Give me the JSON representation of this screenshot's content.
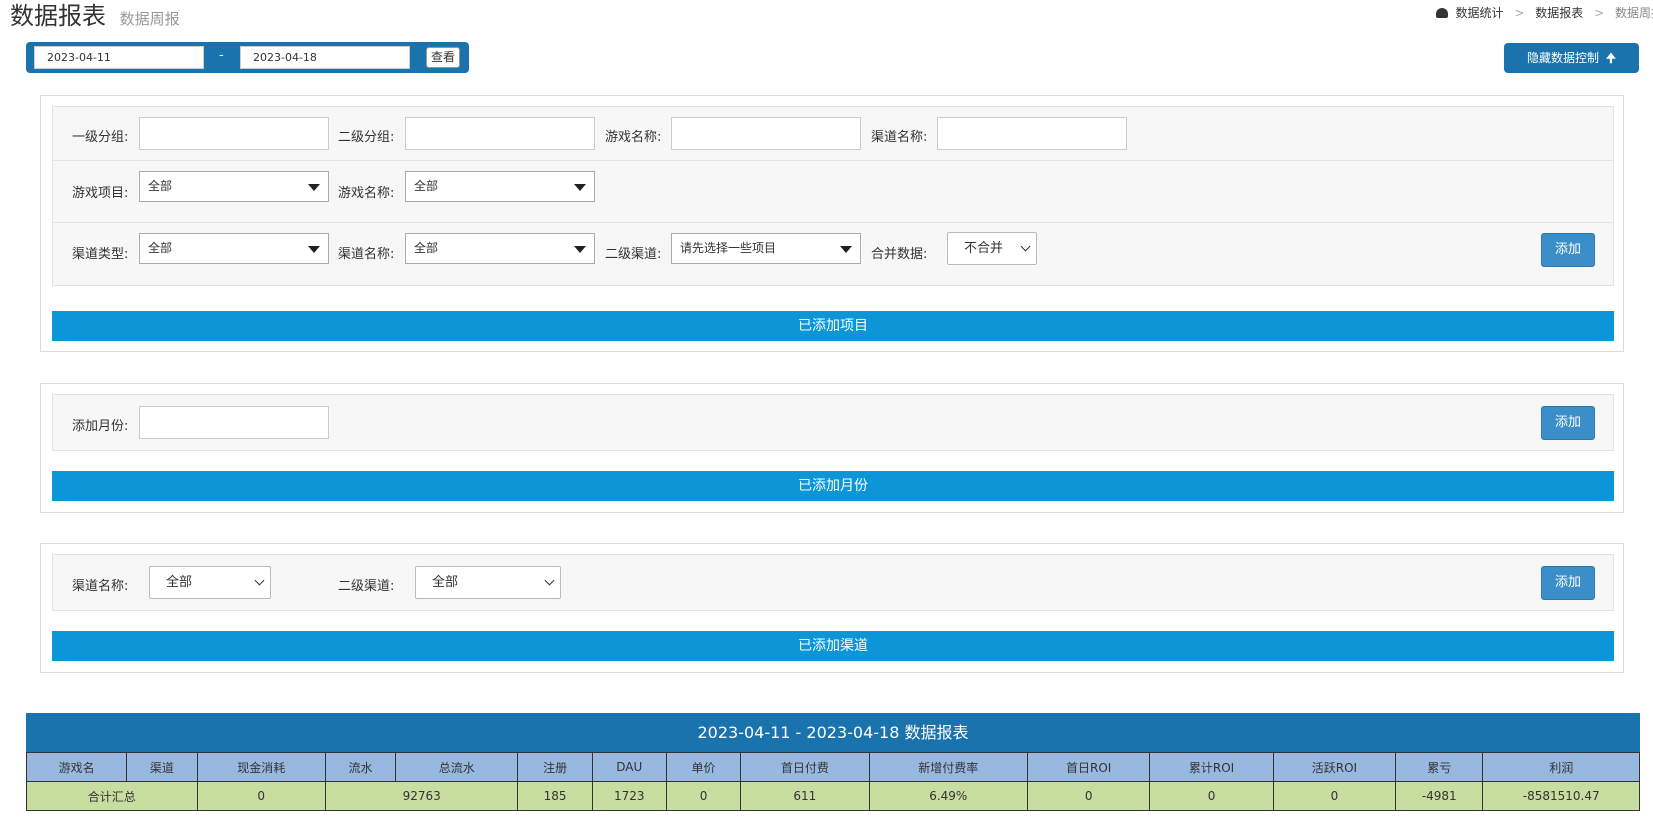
{
  "header": {
    "title": "数据报表",
    "subtitle": "数据周报",
    "breadcrumb": [
      "数据统计",
      "数据报表",
      "数据周报"
    ]
  },
  "datebar": {
    "start": "2023-04-11",
    "separator": "-",
    "end": "2023-04-18",
    "view_label": "查看"
  },
  "hide_control_label": "隐藏数据控制",
  "panel1": {
    "row1": {
      "level1_label": "一级分组:",
      "level2_label": "二级分组:",
      "game_name_label": "游戏名称:",
      "channel_name_label": "渠道名称:"
    },
    "row2": {
      "game_project_label": "游戏项目:",
      "game_project_value": "全部",
      "game_name_label": "游戏名称:",
      "game_name_value": "全部"
    },
    "row3": {
      "channel_type_label": "渠道类型:",
      "channel_type_value": "全部",
      "channel_name_label": "渠道名称:",
      "channel_name_value": "全部",
      "sub_channel_label": "二级渠道:",
      "sub_channel_value": "请先选择一些项目",
      "merge_label": "合并数据:",
      "merge_value": "不合并",
      "add_label": "添加"
    },
    "bar_label": "已添加项目"
  },
  "panel2": {
    "month_label": "添加月份:",
    "add_label": "添加",
    "bar_label": "已添加月份"
  },
  "panel3": {
    "channel_label": "渠道名称:",
    "channel_value": "全部",
    "sub_label": "二级渠道:",
    "sub_value": "全部",
    "add_label": "添加",
    "bar_label": "已添加渠道"
  },
  "report": {
    "title": "2023-04-11 - 2023-04-18 数据报表",
    "columns": [
      "游戏名",
      "渠道",
      "现金消耗",
      "流水",
      "总流水",
      "注册",
      "DAU",
      "单价",
      "首日付费",
      "新增付费率",
      "首日ROI",
      "累计ROI",
      "活跃ROI",
      "累亏",
      "利润"
    ],
    "summary": {
      "label": "合计汇总",
      "cash_cost": "0",
      "total_flow": "92763",
      "register": "185",
      "dau": "1723",
      "unit_price": "0",
      "first_day_pay": "611",
      "new_pay_rate": "6.49%",
      "first_day_roi": "0",
      "cumulative_roi": "0",
      "active_roi": "0",
      "cumulative_loss": "-4981",
      "profit": "-8581510.47"
    }
  }
}
